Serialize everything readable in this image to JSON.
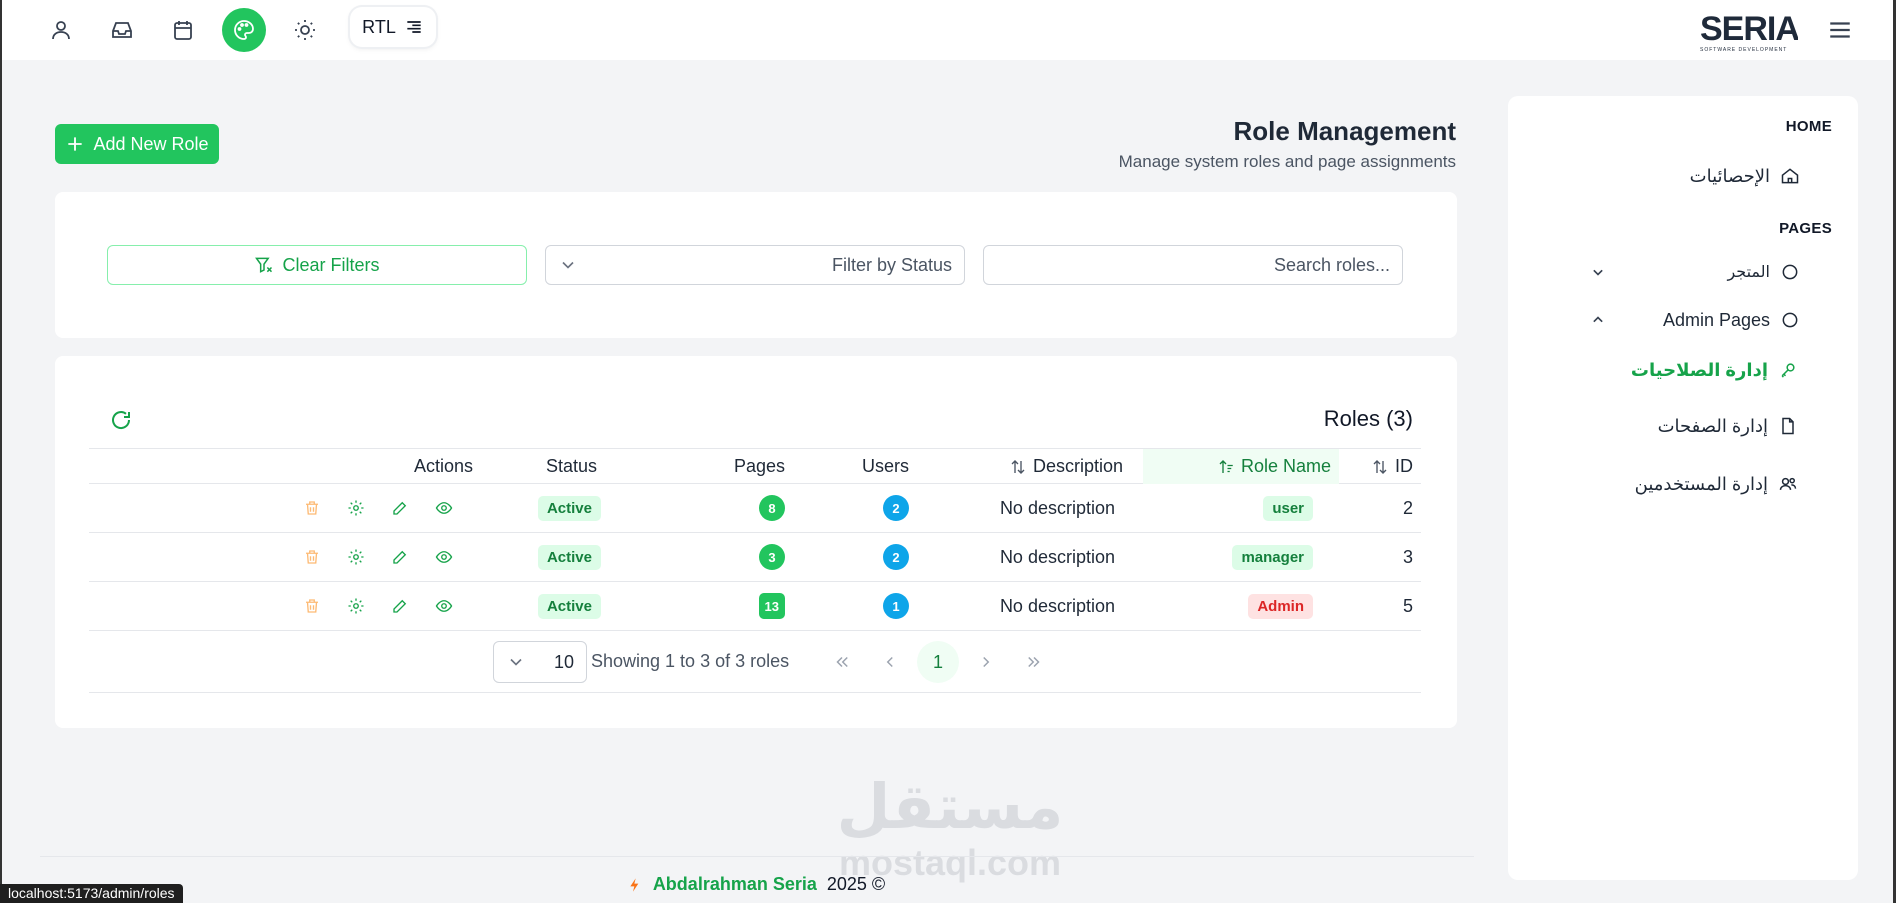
{
  "topbar": {
    "rtl_label": "RTL",
    "logo_text": "SERIA",
    "logo_tagline": "SOFTWARE DEVELOPMENT"
  },
  "sidebar": {
    "home_section": "HOME",
    "stats_label": "الإحصائيات",
    "pages_section": "PAGES",
    "store_label": "المتجر",
    "admin_pages_label": "Admin Pages",
    "permissions_label": "إدارة الصلاحيات",
    "pages_mgmt_label": "إدارة الصفحات",
    "users_mgmt_label": "إدارة المستخدمين"
  },
  "header": {
    "title": "Role Management",
    "subtitle": "Manage system roles and page assignments",
    "add_button": "Add New Role"
  },
  "filters": {
    "clear_label": "Clear Filters",
    "status_placeholder": "Filter by Status",
    "search_placeholder": "Search roles..."
  },
  "table": {
    "title": "Roles (3)",
    "columns": {
      "id": "ID",
      "role_name": "Role Name",
      "description": "Description",
      "users": "Users",
      "pages": "Pages",
      "status": "Status",
      "actions": "Actions"
    },
    "rows": [
      {
        "id": "2",
        "name": "user",
        "description": "No description",
        "users": "2",
        "pages": "8",
        "status": "Active"
      },
      {
        "id": "3",
        "name": "manager",
        "description": "No description",
        "users": "2",
        "pages": "3",
        "status": "Active"
      },
      {
        "id": "5",
        "name": "Admin",
        "description": "No description",
        "users": "1",
        "pages": "13",
        "status": "Active"
      }
    ]
  },
  "pagination": {
    "per_page": "10",
    "info": "Showing 1 to 3 of 3 roles",
    "current_page": "1"
  },
  "footer": {
    "author": "Abdalrahman Seria",
    "copyright": "2025 ©"
  },
  "status_bar": {
    "url": "localhost:5173/admin/roles"
  },
  "watermark": {
    "arabic": "مستقل",
    "latin": "mostaql.com"
  },
  "colors": {
    "accent": "#22c55e",
    "user_badge_bg": "#dcfce7",
    "manager_badge_bg": "#dcfce7",
    "admin_badge_bg": "#fee2e2",
    "admin_badge_text": "#dc2626"
  }
}
